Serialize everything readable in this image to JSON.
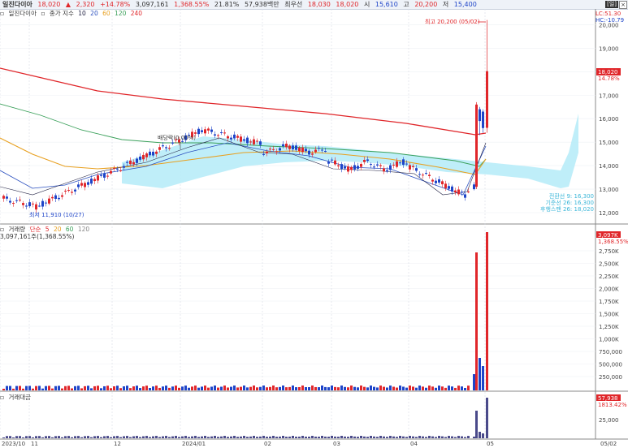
{
  "header": {
    "title": "일진다이아",
    "price": "18,020",
    "direction": "▲",
    "change": "2,320",
    "change_pct": "+14.78%",
    "volume": "3,097,161",
    "volume_pct": "1,368.55%",
    "turnover": "21.81%",
    "amount": "57,938백만",
    "best_ask_label": "최우선",
    "best_ask": "18,030",
    "best_bid": "18,020",
    "open_label": "시",
    "open": "15,610",
    "high_label": "고",
    "high": "20,200",
    "low_label": "저",
    "low": "15,400",
    "period_badge": "[일]"
  },
  "price_panel": {
    "label": "일진다이아",
    "ma_label": "종가 지수",
    "ma_periods": [
      "10",
      "20",
      "60",
      "120",
      "240"
    ],
    "lc": "LC:51.30",
    "hc": "HC:-10.79",
    "high_note": "최고 20,200 (05/02)",
    "low_note": "최저 11,910 (10/27)",
    "dividend_note": "배당락(0.00%)",
    "ichimoku": [
      "전환선 9: 16,300",
      "기준선 26: 16,300",
      "후행스팬 26: 18,020"
    ],
    "current_tag": "18,020",
    "current_pct": "14.78%",
    "y_ticks": [
      "20,000",
      "19,000",
      "18,000",
      "17,000",
      "16,000",
      "15,000",
      "14,000",
      "13,000",
      "12,000"
    ]
  },
  "volume_panel": {
    "label": "거래량",
    "ma_label": "단순",
    "ma_periods": [
      "5",
      "20",
      "60",
      "120"
    ],
    "value_note": "3,097,161주(1,368.55%)",
    "current_tag": "3,097K",
    "current_pct": "1,368.55%",
    "y_ticks": [
      "2,750K",
      "2,500K",
      "2,250K",
      "2,000K",
      "1,750K",
      "1,500K",
      "1,250K",
      "1,000K",
      "750,000",
      "500,000",
      "250,000"
    ]
  },
  "amount_panel": {
    "label": "거래대금",
    "current_tag": "57,938",
    "current_pct": "1813.42%",
    "y_ticks": [
      "25,000"
    ]
  },
  "x_axis": {
    "labels": [
      "2023/10",
      "11",
      "12",
      "2024/01",
      "02",
      "03",
      "04",
      "05"
    ],
    "right_label": "05/02"
  },
  "colors": {
    "up": "#e0262a",
    "down": "#1e44c8",
    "ma240": "#e0262a",
    "ma120": "#3aa05a",
    "ma60": "#e8a020",
    "ma20": "#2a4fbf",
    "ma10": "#222244",
    "cloud": "#b8ecf8",
    "amount_bar": "#4a4a8a"
  }
}
